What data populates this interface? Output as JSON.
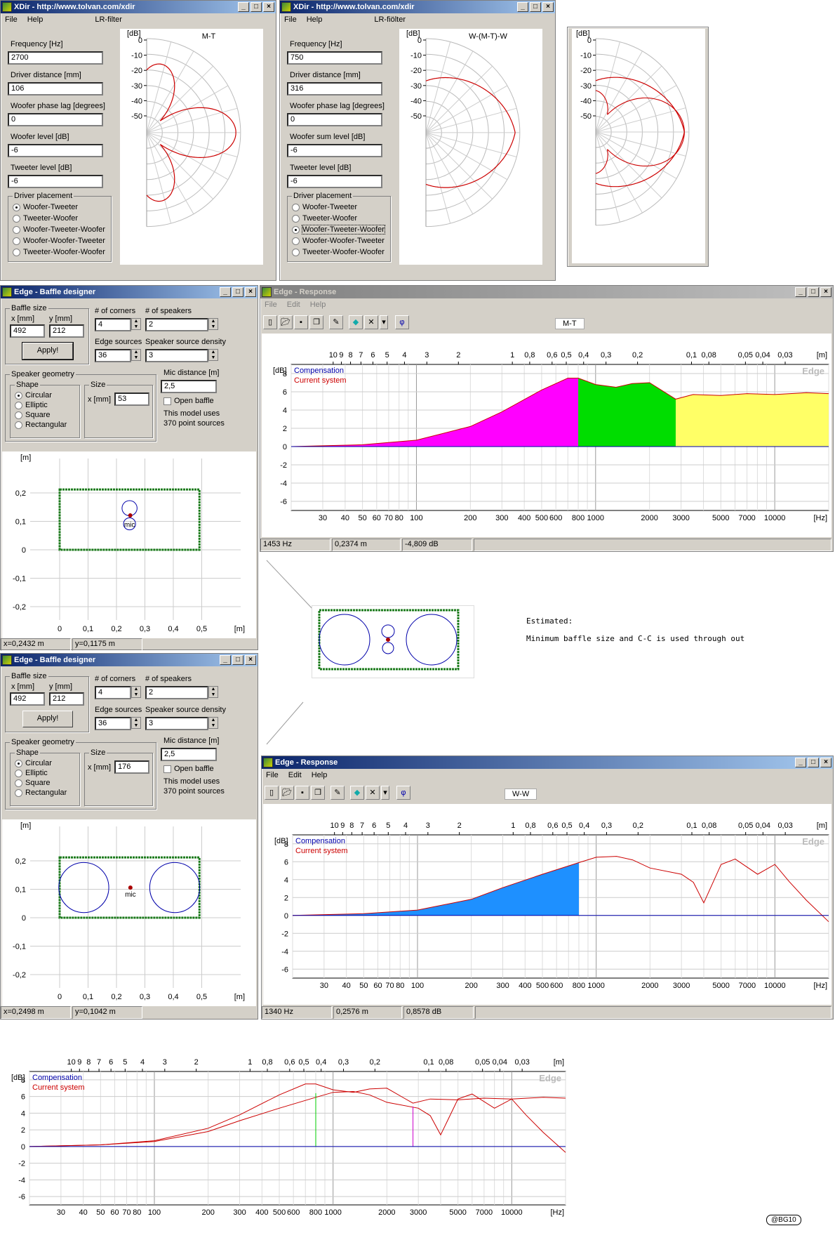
{
  "xdir1": {
    "title": "XDir - http://www.tolvan.com/xdir",
    "menu": [
      "File",
      "Help"
    ],
    "mode": "LR-filter",
    "plot_label": "M-T",
    "fields": [
      {
        "label": "Frequency [Hz]",
        "value": "2700"
      },
      {
        "label": "Driver distance [mm]",
        "value": "106"
      },
      {
        "label": "Woofer phase lag [degrees]",
        "value": "0"
      },
      {
        "label": "Woofer level [dB]",
        "value": "-6"
      },
      {
        "label": "Tweeter level [dB]",
        "value": "-6"
      }
    ],
    "placement_title": "Driver placement",
    "placements": [
      "Woofer-Tweeter",
      "Tweeter-Woofer",
      "Woofer-Tweeter-Woofer",
      "Woofer-Woofer-Tweeter",
      "Tweeter-Woofer-Woofer"
    ],
    "selected": 0
  },
  "xdir2": {
    "title": "XDir - http://www.tolvan.com/xdir",
    "menu": [
      "File",
      "Help"
    ],
    "mode": "LR-fiölter",
    "plot_label": "W-(M-T)-W",
    "fields": [
      {
        "label": "Frequency [Hz]",
        "value": "750"
      },
      {
        "label": "Driver distance [mm]",
        "value": "316"
      },
      {
        "label": "Woofer phase lag [degrees]",
        "value": "0"
      },
      {
        "label": "Woofer sum level [dB]",
        "value": "-6"
      },
      {
        "label": "Tweeter level [dB]",
        "value": "-6"
      }
    ],
    "placement_title": "Driver placement",
    "placements": [
      "Woofer-Tweeter",
      "Tweeter-Woofer",
      "Woofer-Tweeter-Woofer",
      "Woofer-Woofer-Tweeter",
      "Tweeter-Woofer-Woofer"
    ],
    "selected": 2
  },
  "polar": {
    "db_label": "[dB]",
    "db_ticks": [
      "0",
      "-10",
      "-20",
      "-30",
      "-40",
      "-50"
    ]
  },
  "baffle1": {
    "title": "Edge - Baffle designer",
    "baffle_size": "Baffle size",
    "x_label": "x [mm]",
    "y_label": "y [mm]",
    "x": "492",
    "y": "212",
    "apply": "Apply!",
    "corners_label": "# of corners",
    "corners": "4",
    "speakers_label": "# of speakers",
    "speakers": "2",
    "edge_label": "Edge sources",
    "edge": "36",
    "density_label": "Speaker source density",
    "density": "3",
    "geom": "Speaker geometry",
    "shape": "Shape",
    "shapes": [
      "Circular",
      "Elliptic",
      "Square",
      "Rectangular"
    ],
    "size": "Size",
    "size_label": "x [mm]",
    "size_value": "53",
    "mic_label": "Mic distance [m]",
    "mic": "2,5",
    "open_baffle": "Open baffle",
    "model_note1": "This model uses",
    "model_note2": "370 point sources",
    "axis_unit": "[m]",
    "yticks": [
      "0,2",
      "0,1",
      "0",
      "-0,1",
      "-0,2"
    ],
    "xticks": [
      "0",
      "0,1",
      "0,2",
      "0,3",
      "0,4",
      "0,5"
    ],
    "mic_text": "mic",
    "status": [
      "x=0,2432 m",
      "y=0,1175 m"
    ]
  },
  "baffle2": {
    "title": "Edge - Baffle designer",
    "baffle_size": "Baffle size",
    "x_label": "x [mm]",
    "y_label": "y [mm]",
    "x": "492",
    "y": "212",
    "apply": "Apply!",
    "corners_label": "# of corners",
    "corners": "4",
    "speakers_label": "# of speakers",
    "speakers": "2",
    "edge_label": "Edge sources",
    "edge": "36",
    "density_label": "Speaker source density",
    "density": "3",
    "geom": "Speaker geometry",
    "shape": "Shape",
    "shapes": [
      "Circular",
      "Elliptic",
      "Square",
      "Rectangular"
    ],
    "size": "Size",
    "size_label": "x [mm]",
    "size_value": "176",
    "mic_label": "Mic distance [m]",
    "mic": "2,5",
    "open_baffle": "Open baffle",
    "model_note1": "This model uses",
    "model_note2": "370 point sources",
    "axis_unit": "[m]",
    "yticks": [
      "0,2",
      "0,1",
      "0",
      "-0,1",
      "-0,2"
    ],
    "xticks": [
      "0",
      "0,1",
      "0,2",
      "0,3",
      "0,4",
      "0,5"
    ],
    "mic_text": "mic",
    "status": [
      "x=0,2498 m",
      "y=0,1042 m"
    ]
  },
  "resp1": {
    "title": "Edge - Response",
    "menu": [
      "File",
      "Edit",
      "Help"
    ],
    "tab": "M-T",
    "status": [
      "1453 Hz",
      "0,2374 m",
      "-4,809 dB"
    ]
  },
  "resp2": {
    "title": "Edge - Response",
    "menu": [
      "File",
      "Edit",
      "Help"
    ],
    "tab": "W-W",
    "status": [
      "1340 Hz",
      "0,2576 m",
      "0,8578 dB"
    ]
  },
  "resp_common": {
    "m_unit": "[m]",
    "hz_unit": "[Hz]",
    "db_unit": "[dB]",
    "legend_comp": "Compensation",
    "legend_cur": "Current system",
    "watermark": "Edge",
    "top_ticks": [
      "10",
      "9",
      "8",
      "7",
      "6",
      "5",
      "4",
      "3",
      "2",
      "1",
      "0,8",
      "0,6",
      "0,5",
      "0,4",
      "0,3",
      "0,2",
      "0,1",
      "0,08",
      "0,05",
      "0,04",
      "0,03"
    ],
    "bottom_ticks": [
      "30",
      "40",
      "50",
      "60",
      "70",
      "80",
      "100",
      "200",
      "300",
      "400",
      "500",
      "600",
      "800",
      "1000",
      "2000",
      "3000",
      "5000",
      "7000",
      "10000"
    ],
    "y_ticks": [
      "8",
      "6",
      "4",
      "2",
      "0",
      "-2",
      "-4",
      "-6"
    ]
  },
  "note": {
    "line1": "Estimated:",
    "line2": "Minimum baffle size and C-C is used through out"
  },
  "credit": "@BG10",
  "chart_data": [
    {
      "type": "line",
      "title": "M-T",
      "xlabel": "[Hz]",
      "ylabel": "[dB]",
      "x_scale": "log",
      "xlim": [
        20,
        20000
      ],
      "ylim": [
        -7,
        9
      ],
      "series": [
        {
          "name": "Current system",
          "x": [
            20,
            50,
            100,
            200,
            300,
            500,
            700,
            800,
            1000,
            1300,
            1600,
            2000,
            2500,
            2800,
            3500,
            5000,
            7000,
            10000,
            15000,
            20000
          ],
          "y": [
            0,
            0.2,
            0.7,
            2.2,
            3.8,
            6.2,
            7.5,
            7.5,
            6.8,
            6.5,
            6.9,
            7.0,
            5.8,
            5.2,
            5.7,
            5.6,
            5.8,
            5.7,
            5.9,
            5.8
          ]
        },
        {
          "name": "Compensation",
          "x": [
            20,
            20000
          ],
          "y": [
            0,
            0
          ]
        }
      ]
    },
    {
      "type": "line",
      "title": "W-W",
      "xlabel": "[Hz]",
      "ylabel": "[dB]",
      "x_scale": "log",
      "xlim": [
        20,
        20000
      ],
      "ylim": [
        -7,
        9
      ],
      "series": [
        {
          "name": "Current system",
          "x": [
            20,
            50,
            100,
            200,
            300,
            500,
            800,
            1000,
            1300,
            1600,
            2000,
            3000,
            3500,
            4000,
            5000,
            6000,
            8000,
            10000,
            12000,
            15000,
            20000
          ],
          "y": [
            0,
            0.2,
            0.6,
            1.8,
            3.1,
            4.6,
            5.9,
            6.5,
            6.6,
            6.2,
            5.3,
            4.6,
            3.7,
            1.4,
            5.7,
            6.3,
            4.6,
            5.7,
            3.8,
            1.7,
            -0.7
          ]
        },
        {
          "name": "Compensation",
          "x": [
            20,
            20000
          ],
          "y": [
            0,
            0
          ]
        }
      ]
    },
    {
      "type": "line",
      "title": "",
      "xlabel": "[Hz]",
      "ylabel": "[dB]",
      "x_scale": "log",
      "xlim": [
        20,
        20000
      ],
      "ylim": [
        -7,
        9
      ],
      "series": [
        {
          "name": "Current system",
          "x": [
            20,
            50,
            100,
            200,
            300,
            500,
            800,
            1000,
            1300,
            1600,
            2000,
            3000,
            3500,
            4000,
            5000,
            6000,
            8000,
            10000,
            12000,
            15000,
            20000
          ],
          "y": [
            0,
            0.2,
            0.6,
            1.8,
            3.1,
            4.6,
            5.9,
            6.5,
            6.6,
            6.2,
            5.3,
            4.6,
            3.7,
            1.4,
            5.7,
            6.3,
            4.6,
            5.7,
            3.8,
            1.7,
            -0.7
          ]
        },
        {
          "name": "Current system",
          "x": [
            20,
            50,
            100,
            200,
            300,
            500,
            700,
            800,
            1000,
            1300,
            1600,
            2000,
            2500,
            2800,
            3500,
            5000,
            7000,
            10000,
            15000,
            20000
          ],
          "y": [
            0,
            0.2,
            0.7,
            2.2,
            3.8,
            6.2,
            7.5,
            7.5,
            6.8,
            6.5,
            6.9,
            7.0,
            5.8,
            5.2,
            5.7,
            5.6,
            5.8,
            5.7,
            5.9,
            5.8
          ]
        },
        {
          "name": "Compensation",
          "x": [
            20,
            20000
          ],
          "y": [
            0,
            0
          ]
        }
      ],
      "markers": [
        {
          "x": 800
        },
        {
          "x": 2800
        }
      ]
    }
  ]
}
